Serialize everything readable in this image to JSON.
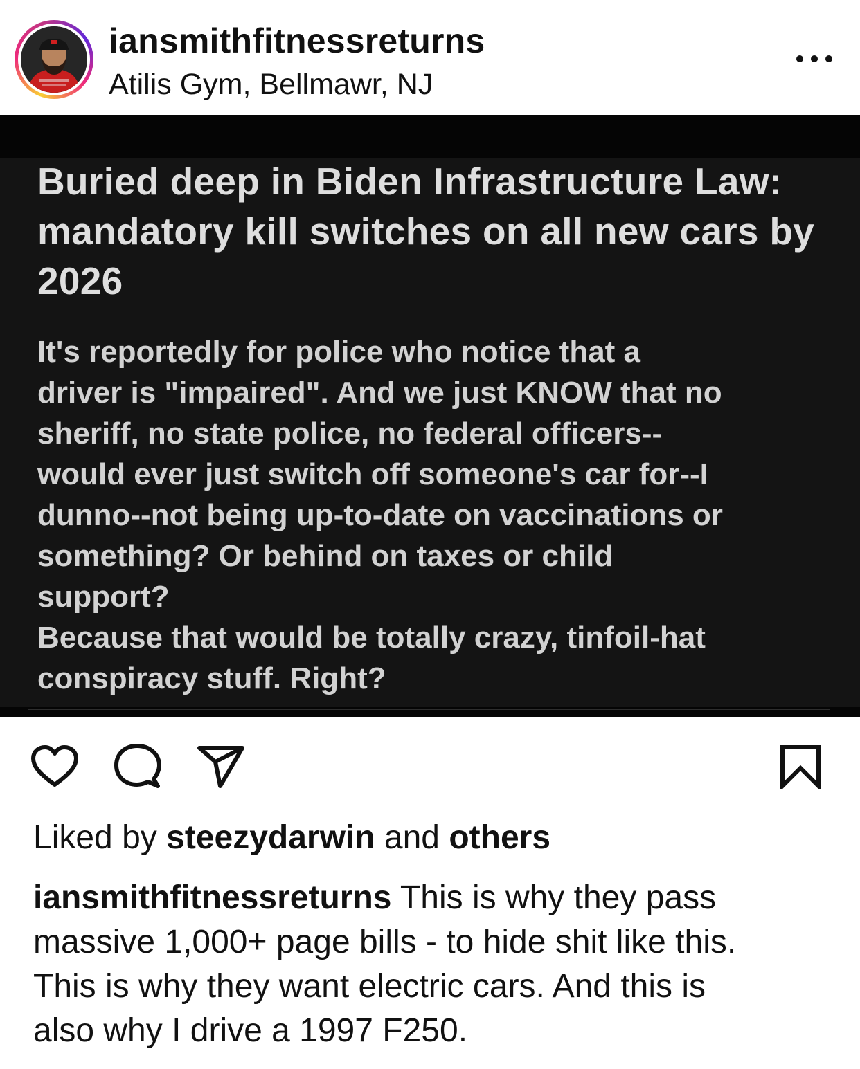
{
  "header": {
    "username": "iansmithfitnessreturns",
    "location": "Atilis Gym, Bellmawr, NJ",
    "more_icon": "ellipsis-icon"
  },
  "media": {
    "title": "Buried deep in Biden Infrastructure Law: mandatory kill switches on all new cars by 2026",
    "body_lines": [
      "It's reportedly for police who notice that a",
      "driver is \"impaired\".  And we just KNOW that no",
      "sheriff, no state police, no federal officers--",
      "would ever just switch off someone's car for--I",
      "dunno--not being up-to-date on vaccinations or",
      "something?  Or behind on taxes or child",
      "support?",
      "Because that would be totally crazy, tinfoil-hat",
      "conspiracy stuff.  Right?"
    ]
  },
  "actions": {
    "like_icon": "heart-icon",
    "comment_icon": "comment-icon",
    "share_icon": "send-icon",
    "save_icon": "bookmark-icon"
  },
  "likes": {
    "prefix": "Liked by ",
    "user": "steezydarwin",
    "middle": " and ",
    "others": "others"
  },
  "caption": {
    "username": "iansmithfitnessreturns",
    "first_line_rest": " This is why they pass",
    "lines": [
      "massive 1,000+ page bills - to hide shit like this.",
      "This is why they want electric cars. And this is",
      "also why I drive a 1997 F250."
    ]
  },
  "colors": {
    "ring_start": "#f9ce34",
    "ring_mid": "#ee2a7b",
    "ring_end": "#6228d7",
    "media_bg": "#141414",
    "media_text": "#d2d2d2"
  }
}
